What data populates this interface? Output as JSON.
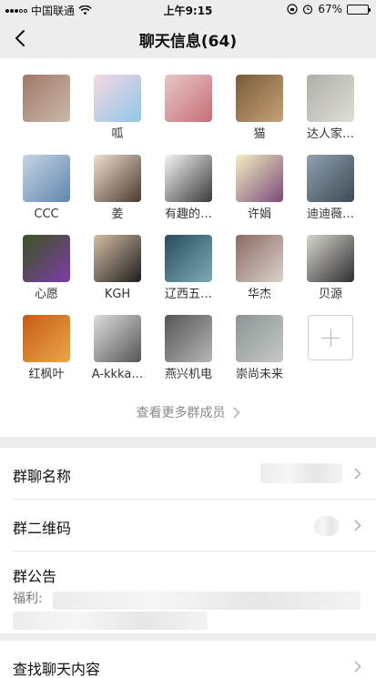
{
  "status": {
    "carrier": "中国联通",
    "time": "上午9:15",
    "battery_percent": "67%",
    "battery_level": 0.67
  },
  "nav": {
    "back_icon": "chevron-left-icon",
    "title": "聊天信息(64)"
  },
  "members": [
    {
      "name": "",
      "colors": [
        "#a2786a",
        "#c9b9a9"
      ]
    },
    {
      "name": "呱",
      "colors": [
        "#f7d7e2",
        "#8ec6e8"
      ]
    },
    {
      "name": "",
      "colors": [
        "#e6c7c8",
        "#c76e76"
      ]
    },
    {
      "name": "猫",
      "colors": [
        "#7b5a3b",
        "#c4a276"
      ]
    },
    {
      "name": "达人家…",
      "colors": [
        "#b1aea7",
        "#deddd8"
      ]
    },
    {
      "name": "CCC",
      "colors": [
        "#c6d4e4",
        "#5f86ae"
      ]
    },
    {
      "name": "姜",
      "colors": [
        "#efe0d0",
        "#4a3a2e"
      ]
    },
    {
      "name": "有趣的…",
      "colors": [
        "#f5f5f5",
        "#3a3a3a"
      ]
    },
    {
      "name": "许娟",
      "colors": [
        "#f4efc0",
        "#7b4a7b"
      ]
    },
    {
      "name": "迪迪薇…",
      "colors": [
        "#8fa1b2",
        "#3e4a52"
      ]
    },
    {
      "name": "心愿",
      "colors": [
        "#3b5520",
        "#7d3ba8"
      ]
    },
    {
      "name": "KGH",
      "colors": [
        "#d6bea4",
        "#1e1e1e"
      ]
    },
    {
      "name": "辽西五…",
      "colors": [
        "#294d5e",
        "#7ea9b4"
      ]
    },
    {
      "name": "华杰",
      "colors": [
        "#8c6b63",
        "#d9d0cc"
      ]
    },
    {
      "name": "贝源",
      "colors": [
        "#d8d4cc",
        "#2f2f2f"
      ]
    },
    {
      "name": "红枫叶",
      "colors": [
        "#c65c14",
        "#eba64a"
      ]
    },
    {
      "name": "A-kkka…",
      "colors": [
        "#dedede",
        "#555555"
      ]
    },
    {
      "name": "燕兴机电",
      "colors": [
        "#565656",
        "#b5b5b5"
      ]
    },
    {
      "name": "崇尚未来",
      "colors": [
        "#8d9393",
        "#c5c9c8"
      ]
    }
  ],
  "add_member_icon": "plus-icon",
  "more_members": "查看更多群成员",
  "settings": {
    "group_name_label": "群聊名称",
    "qr_label": "群二维码",
    "notice_label": "群公告",
    "notice_prefix": "福利:",
    "search_label": "查找聊天内容"
  },
  "colors": {
    "background": "#ededed",
    "card": "#ffffff",
    "secondary_text": "#8a8a8a"
  }
}
